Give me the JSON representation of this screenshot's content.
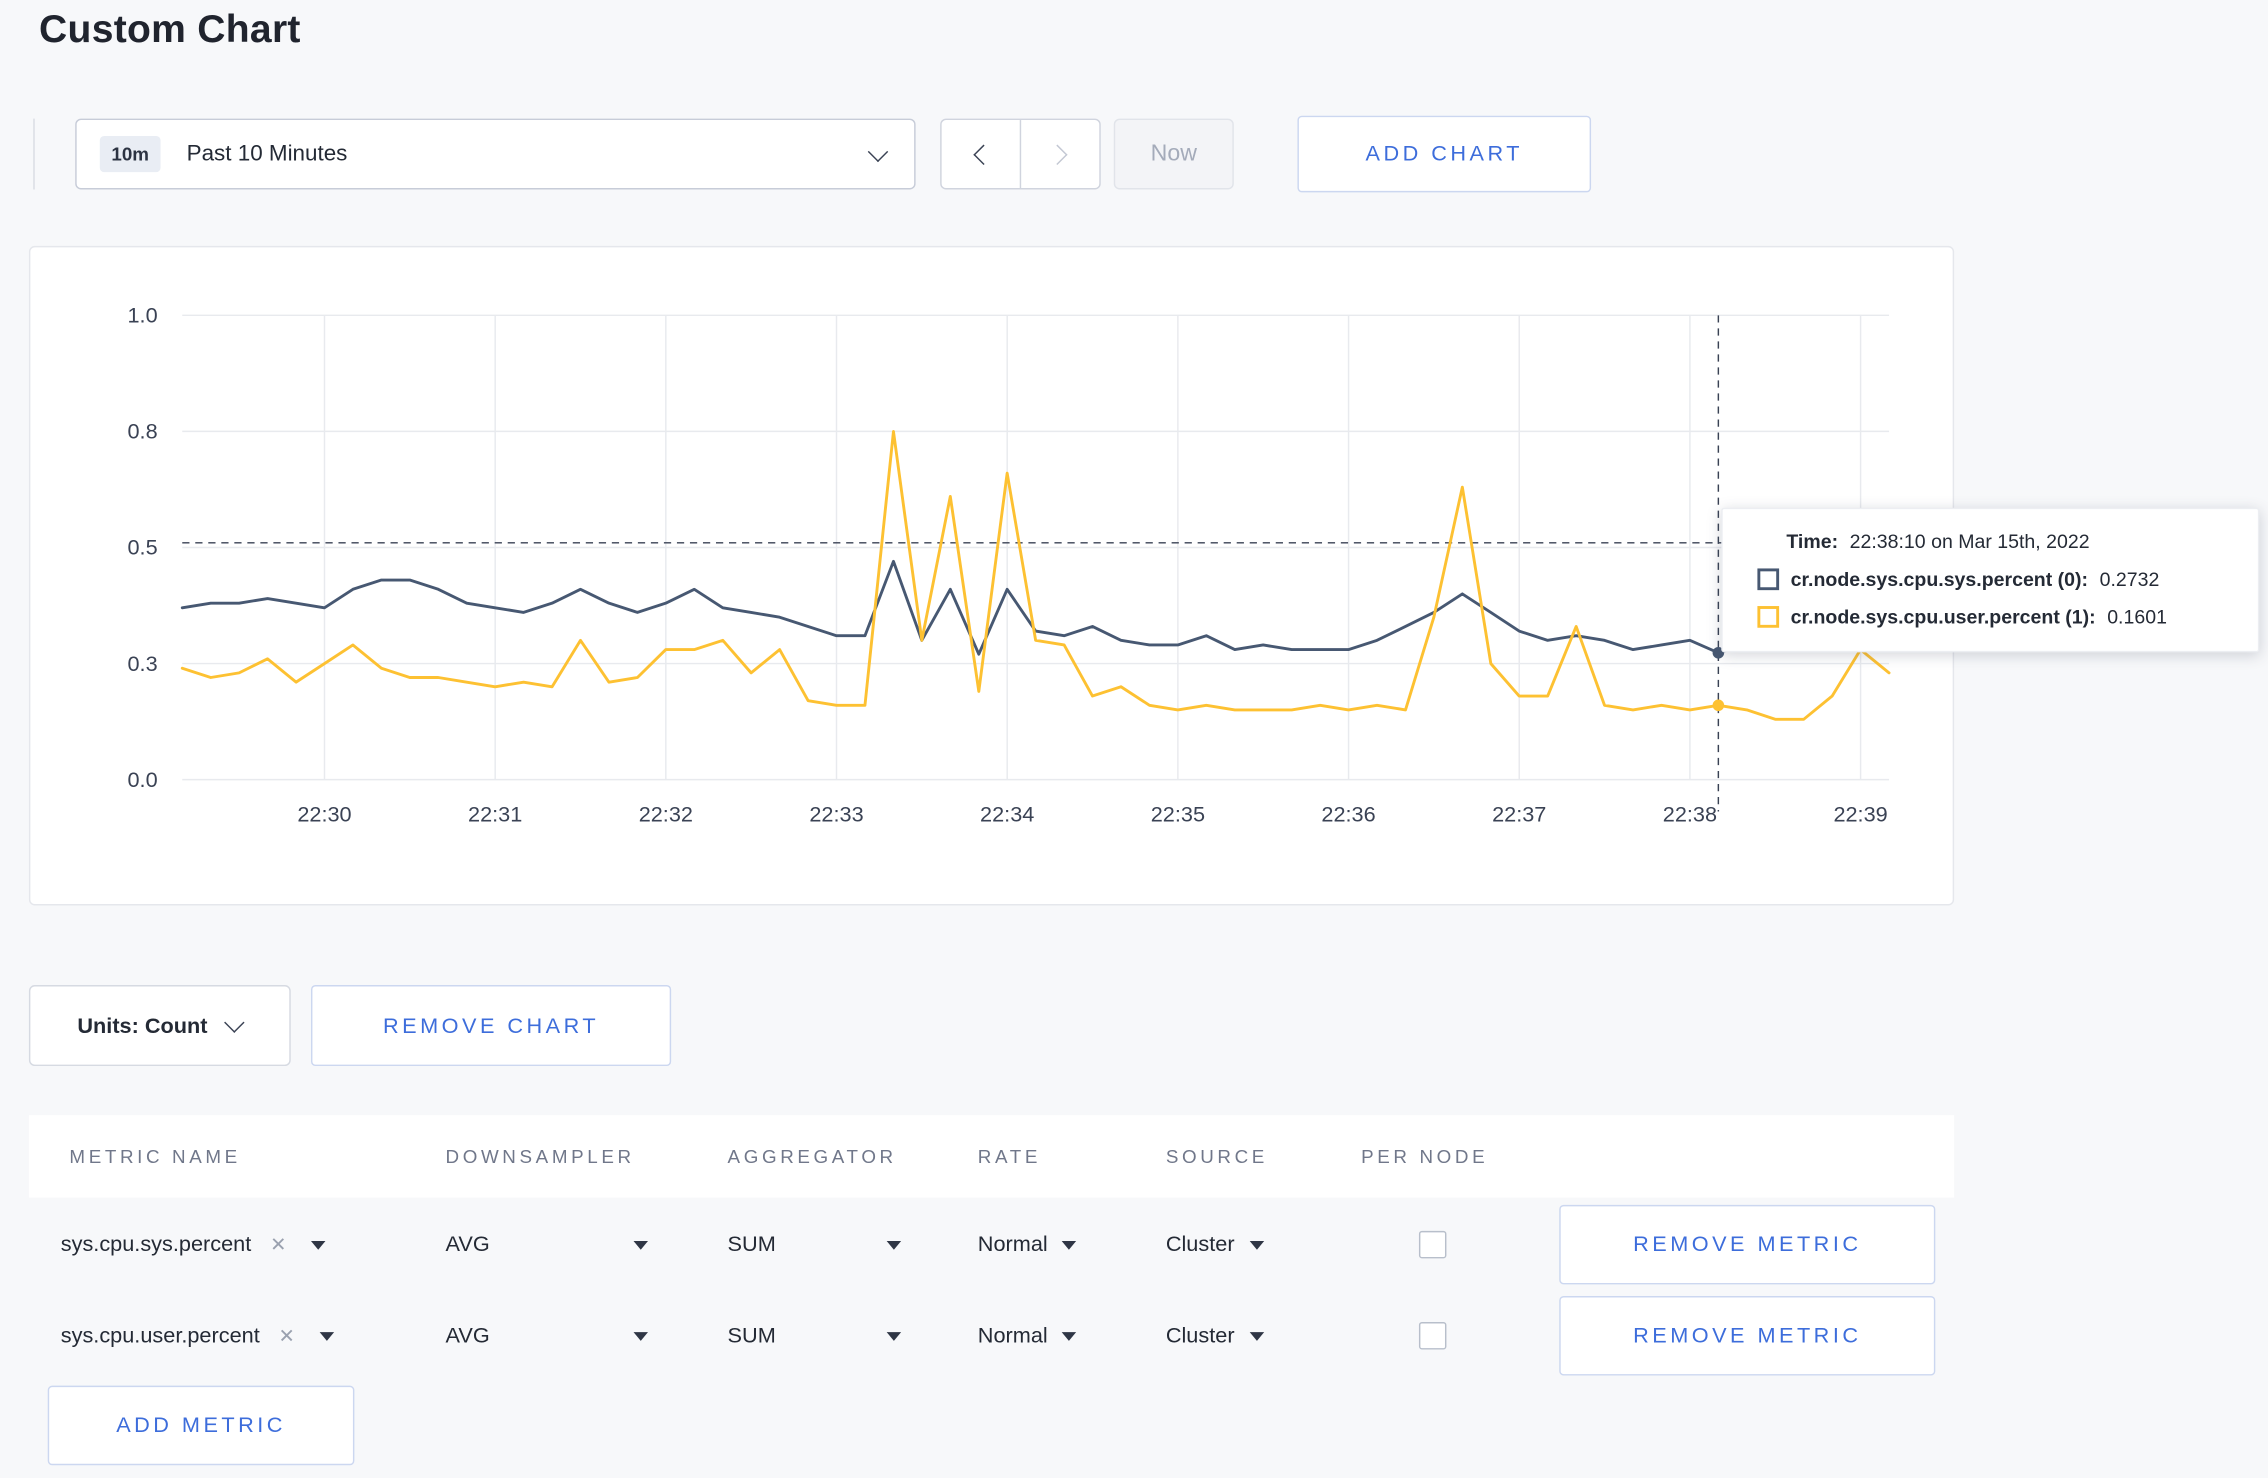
{
  "page": {
    "title": "Custom Chart"
  },
  "colors": {
    "accent_blue": "#3d6ddb",
    "series_sys": "#475872",
    "series_user": "#fdc132",
    "grid": "#e8eaee",
    "crosshair": "#3a4254"
  },
  "icons": {
    "close": "✕",
    "chevron_down": "chevron-down",
    "chevron_left": "chevron-left",
    "chevron_right": "chevron-right",
    "caret_down": "caret-down"
  },
  "toolbar": {
    "range_badge": "10m",
    "range_label": "Past 10 Minutes",
    "now_label": "Now",
    "add_chart_label": "ADD CHART"
  },
  "chart_data": {
    "type": "line",
    "title": "",
    "xlabel": "",
    "ylabel": "",
    "ylim": [
      0,
      1
    ],
    "grid": true,
    "grid_color": "#e8eaee",
    "y_ticks": [
      {
        "value": 0.0,
        "label": "0.0"
      },
      {
        "value": 0.25,
        "label": "0.3"
      },
      {
        "value": 0.5,
        "label": "0.5"
      },
      {
        "value": 0.75,
        "label": "0.8"
      },
      {
        "value": 1.0,
        "label": "1.0"
      }
    ],
    "x_ticks": [
      "22:30",
      "22:31",
      "22:32",
      "22:33",
      "22:34",
      "22:35",
      "22:36",
      "22:37",
      "22:38",
      "22:39"
    ],
    "first_tick_index": 5,
    "tick_step": 6,
    "crosshair": {
      "index": 54,
      "time": "22:38:10",
      "y_value": 0.51
    },
    "series": [
      {
        "name": "cr.node.sys.cpu.sys.percent",
        "color": "#475872",
        "values": [
          0.37,
          0.38,
          0.38,
          0.39,
          0.38,
          0.37,
          0.41,
          0.43,
          0.43,
          0.41,
          0.38,
          0.37,
          0.36,
          0.38,
          0.41,
          0.38,
          0.36,
          0.38,
          0.41,
          0.37,
          0.36,
          0.35,
          0.33,
          0.31,
          0.31,
          0.47,
          0.3,
          0.41,
          0.27,
          0.41,
          0.32,
          0.31,
          0.33,
          0.3,
          0.29,
          0.29,
          0.31,
          0.28,
          0.29,
          0.28,
          0.28,
          0.28,
          0.3,
          0.33,
          0.36,
          0.4,
          0.36,
          0.32,
          0.3,
          0.31,
          0.3,
          0.28,
          0.29,
          0.3,
          0.2732,
          0.29,
          0.3,
          0.28,
          0.3,
          0.31,
          0.3
        ]
      },
      {
        "name": "cr.node.sys.cpu.user.percent",
        "color": "#fdc132",
        "values": [
          0.24,
          0.22,
          0.23,
          0.26,
          0.21,
          0.25,
          0.29,
          0.24,
          0.22,
          0.22,
          0.21,
          0.2,
          0.21,
          0.2,
          0.3,
          0.21,
          0.22,
          0.28,
          0.28,
          0.3,
          0.23,
          0.28,
          0.17,
          0.16,
          0.16,
          0.75,
          0.3,
          0.61,
          0.19,
          0.66,
          0.3,
          0.29,
          0.18,
          0.2,
          0.16,
          0.15,
          0.16,
          0.15,
          0.15,
          0.15,
          0.16,
          0.15,
          0.16,
          0.15,
          0.35,
          0.63,
          0.25,
          0.18,
          0.18,
          0.33,
          0.16,
          0.15,
          0.16,
          0.15,
          0.1601,
          0.15,
          0.13,
          0.13,
          0.18,
          0.28,
          0.23
        ]
      }
    ]
  },
  "tooltip": {
    "time_label": "Time:",
    "time_value": "22:38:10 on Mar 15th, 2022",
    "rows": [
      {
        "name": "cr.node.sys.cpu.sys.percent (0):",
        "value": "0.2732",
        "color": "#475872"
      },
      {
        "name": "cr.node.sys.cpu.user.percent (1):",
        "value": "0.1601",
        "color": "#fdc132"
      }
    ]
  },
  "chart_controls": {
    "units_label": "Units: Count",
    "remove_chart_label": "REMOVE CHART"
  },
  "metrics_table": {
    "headers": [
      "METRIC NAME",
      "DOWNSAMPLER",
      "AGGREGATOR",
      "RATE",
      "SOURCE",
      "PER NODE"
    ],
    "rows": [
      {
        "metric": "sys.cpu.sys.percent",
        "downsampler": "AVG",
        "aggregator": "SUM",
        "rate": "Normal",
        "source": "Cluster",
        "per_node_checked": false,
        "remove_label": "REMOVE METRIC"
      },
      {
        "metric": "sys.cpu.user.percent",
        "downsampler": "AVG",
        "aggregator": "SUM",
        "rate": "Normal",
        "source": "Cluster",
        "per_node_checked": false,
        "remove_label": "REMOVE METRIC"
      }
    ],
    "add_metric_label": "ADD METRIC"
  }
}
